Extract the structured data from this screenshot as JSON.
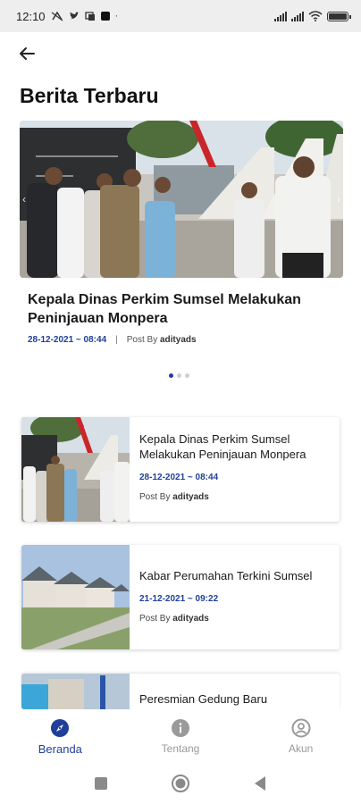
{
  "status_bar": {
    "time": "12:10",
    "left_icons": [
      "data-saver-icon",
      "twitter-icon",
      "messenger-icon",
      "app-icon",
      "dot-icon"
    ],
    "right_icons": [
      "signal-icon",
      "signal-icon",
      "wifi-icon",
      "battery-icon"
    ],
    "battery_level": 1.0
  },
  "header": {
    "back_icon": "arrow-left-icon",
    "title": "Berita Terbaru"
  },
  "carousel": {
    "title": "Kepala Dinas Perkim Sumsel Melakukan Peninjauan Monpera",
    "date": "28-12-2021 ~ 08:44",
    "separator": "|",
    "post_by_label": "Post By",
    "author": "adityads",
    "dots_count": 3,
    "active_dot": 0
  },
  "news": [
    {
      "title": "Kepala Dinas Perkim Sumsel Melakukan Peninjauan Monpera",
      "date": "28-12-2021 ~ 08:44",
      "post_by_label": "Post By",
      "author": "adityads"
    },
    {
      "title": "Kabar Perumahan Terkini Sumsel",
      "date": "21-12-2021 ~ 09:22",
      "post_by_label": "Post By",
      "author": "adityads"
    },
    {
      "title": "Peresmian Gedung Baru"
    }
  ],
  "bottom_nav": {
    "items": [
      {
        "label": "Beranda",
        "icon": "compass-icon",
        "active": true
      },
      {
        "label": "Tentang",
        "icon": "info-icon",
        "active": false
      },
      {
        "label": "Akun",
        "icon": "account-icon",
        "active": false
      }
    ]
  },
  "system_nav": {
    "icons": [
      "recents-square-icon",
      "home-circle-icon",
      "back-triangle-icon"
    ]
  },
  "colors": {
    "accent": "#1f3f9a",
    "inactive": "#9a9a9a",
    "status_bar_bg": "#eeeeee"
  }
}
